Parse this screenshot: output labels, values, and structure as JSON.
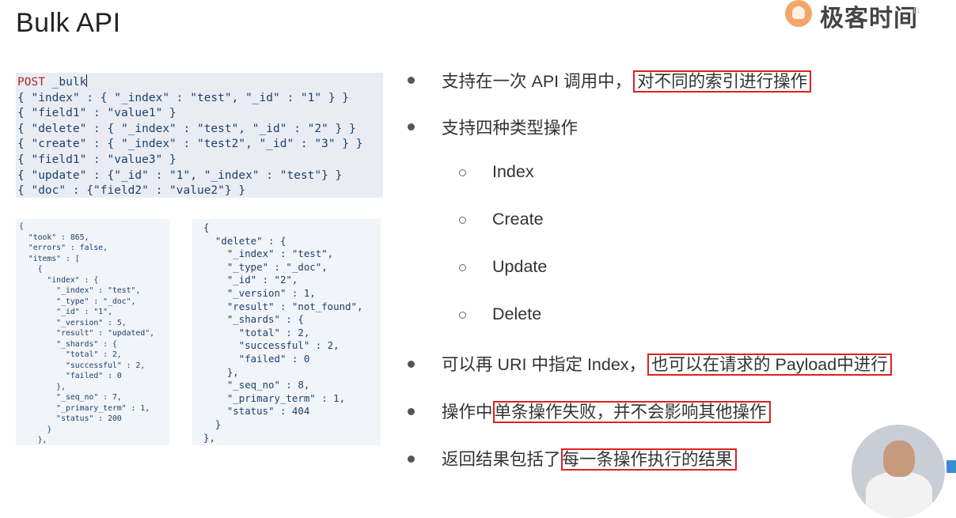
{
  "slide": {
    "title": "Bulk API"
  },
  "brand": {
    "name": "极客时间",
    "small_mark": "lli"
  },
  "request_code": {
    "method": "POST",
    "path": " _bulk",
    "lines": [
      "{ \"index\" : { \"_index\" : \"test\", \"_id\" : \"1\" } }",
      "{ \"field1\" : \"value1\" }",
      "{ \"delete\" : { \"_index\" : \"test\", \"_id\" : \"2\" } }",
      "{ \"create\" : { \"_index\" : \"test2\", \"_id\" : \"3\" } }",
      "{ \"field1\" : \"value3\" }",
      "{ \"update\" : {\"_id\" : \"1\", \"_index\" : \"test\"} }",
      "{ \"doc\" : {\"field2\" : \"value2\"} }"
    ]
  },
  "response_left": [
    "{",
    "  \"took\" : 865,",
    "  \"errors\" : false,",
    "  \"items\" : [",
    "    {",
    "      \"index\" : {",
    "        \"_index\" : \"test\",",
    "        \"_type\" : \"_doc\",",
    "        \"_id\" : \"1\",",
    "        \"_version\" : 5,",
    "        \"result\" : \"updated\",",
    "        \"_shards\" : {",
    "          \"total\" : 2,",
    "          \"successful\" : 2,",
    "          \"failed\" : 0",
    "        },",
    "        \"_seq_no\" : 7,",
    "        \"_primary_term\" : 1,",
    "        \"status\" : 200",
    "      }",
    "    },"
  ],
  "response_right": [
    "{",
    "  \"delete\" : {",
    "    \"_index\" : \"test\",",
    "    \"_type\" : \"_doc\",",
    "    \"_id\" : \"2\",",
    "    \"_version\" : 1,",
    "    \"result\" : \"not_found\",",
    "    \"_shards\" : {",
    "      \"total\" : 2,",
    "      \"successful\" : 2,",
    "      \"failed\" : 0",
    "    },",
    "    \"_seq_no\" : 8,",
    "    \"_primary_term\" : 1,",
    "    \"status\" : 404",
    "  }",
    "},"
  ],
  "bullets": {
    "b1_plain": "支持在一次 API 调用中，",
    "b1_highlight": "对不同的索引进行操作",
    "b2_plain": "支持四种类型操作",
    "sub": [
      "Index",
      "Create",
      "Update",
      "Delete"
    ],
    "b3_plain": "可以再 URI 中指定 Index，",
    "b3_highlight": "也可以在请求的 Payload中进行",
    "b4_plain": "操作中",
    "b4_highlight": "单条操作失败，并不会影响其他操作",
    "b5_plain": "返回结果包括了",
    "b5_highlight": "每一条操作执行的结果"
  },
  "colors": {
    "highlight_border": "#e02020",
    "code_bg": "#e9edf3",
    "code_text": "#1d3f6e",
    "post_keyword": "#b3262b"
  }
}
